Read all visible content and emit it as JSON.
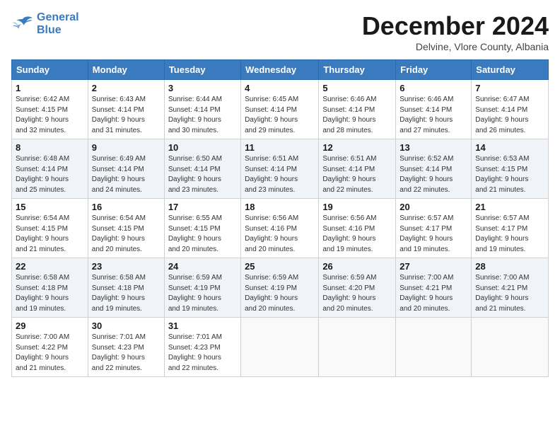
{
  "logo": {
    "line1": "General",
    "line2": "Blue"
  },
  "title": "December 2024",
  "location": "Delvine, Vlore County, Albania",
  "days_header": [
    "Sunday",
    "Monday",
    "Tuesday",
    "Wednesday",
    "Thursday",
    "Friday",
    "Saturday"
  ],
  "weeks": [
    [
      {
        "day": "1",
        "info": "Sunrise: 6:42 AM\nSunset: 4:15 PM\nDaylight: 9 hours\nand 32 minutes."
      },
      {
        "day": "2",
        "info": "Sunrise: 6:43 AM\nSunset: 4:14 PM\nDaylight: 9 hours\nand 31 minutes."
      },
      {
        "day": "3",
        "info": "Sunrise: 6:44 AM\nSunset: 4:14 PM\nDaylight: 9 hours\nand 30 minutes."
      },
      {
        "day": "4",
        "info": "Sunrise: 6:45 AM\nSunset: 4:14 PM\nDaylight: 9 hours\nand 29 minutes."
      },
      {
        "day": "5",
        "info": "Sunrise: 6:46 AM\nSunset: 4:14 PM\nDaylight: 9 hours\nand 28 minutes."
      },
      {
        "day": "6",
        "info": "Sunrise: 6:46 AM\nSunset: 4:14 PM\nDaylight: 9 hours\nand 27 minutes."
      },
      {
        "day": "7",
        "info": "Sunrise: 6:47 AM\nSunset: 4:14 PM\nDaylight: 9 hours\nand 26 minutes."
      }
    ],
    [
      {
        "day": "8",
        "info": "Sunrise: 6:48 AM\nSunset: 4:14 PM\nDaylight: 9 hours\nand 25 minutes."
      },
      {
        "day": "9",
        "info": "Sunrise: 6:49 AM\nSunset: 4:14 PM\nDaylight: 9 hours\nand 24 minutes."
      },
      {
        "day": "10",
        "info": "Sunrise: 6:50 AM\nSunset: 4:14 PM\nDaylight: 9 hours\nand 23 minutes."
      },
      {
        "day": "11",
        "info": "Sunrise: 6:51 AM\nSunset: 4:14 PM\nDaylight: 9 hours\nand 23 minutes."
      },
      {
        "day": "12",
        "info": "Sunrise: 6:51 AM\nSunset: 4:14 PM\nDaylight: 9 hours\nand 22 minutes."
      },
      {
        "day": "13",
        "info": "Sunrise: 6:52 AM\nSunset: 4:14 PM\nDaylight: 9 hours\nand 22 minutes."
      },
      {
        "day": "14",
        "info": "Sunrise: 6:53 AM\nSunset: 4:15 PM\nDaylight: 9 hours\nand 21 minutes."
      }
    ],
    [
      {
        "day": "15",
        "info": "Sunrise: 6:54 AM\nSunset: 4:15 PM\nDaylight: 9 hours\nand 21 minutes."
      },
      {
        "day": "16",
        "info": "Sunrise: 6:54 AM\nSunset: 4:15 PM\nDaylight: 9 hours\nand 20 minutes."
      },
      {
        "day": "17",
        "info": "Sunrise: 6:55 AM\nSunset: 4:15 PM\nDaylight: 9 hours\nand 20 minutes."
      },
      {
        "day": "18",
        "info": "Sunrise: 6:56 AM\nSunset: 4:16 PM\nDaylight: 9 hours\nand 20 minutes."
      },
      {
        "day": "19",
        "info": "Sunrise: 6:56 AM\nSunset: 4:16 PM\nDaylight: 9 hours\nand 19 minutes."
      },
      {
        "day": "20",
        "info": "Sunrise: 6:57 AM\nSunset: 4:17 PM\nDaylight: 9 hours\nand 19 minutes."
      },
      {
        "day": "21",
        "info": "Sunrise: 6:57 AM\nSunset: 4:17 PM\nDaylight: 9 hours\nand 19 minutes."
      }
    ],
    [
      {
        "day": "22",
        "info": "Sunrise: 6:58 AM\nSunset: 4:18 PM\nDaylight: 9 hours\nand 19 minutes."
      },
      {
        "day": "23",
        "info": "Sunrise: 6:58 AM\nSunset: 4:18 PM\nDaylight: 9 hours\nand 19 minutes."
      },
      {
        "day": "24",
        "info": "Sunrise: 6:59 AM\nSunset: 4:19 PM\nDaylight: 9 hours\nand 19 minutes."
      },
      {
        "day": "25",
        "info": "Sunrise: 6:59 AM\nSunset: 4:19 PM\nDaylight: 9 hours\nand 20 minutes."
      },
      {
        "day": "26",
        "info": "Sunrise: 6:59 AM\nSunset: 4:20 PM\nDaylight: 9 hours\nand 20 minutes."
      },
      {
        "day": "27",
        "info": "Sunrise: 7:00 AM\nSunset: 4:21 PM\nDaylight: 9 hours\nand 20 minutes."
      },
      {
        "day": "28",
        "info": "Sunrise: 7:00 AM\nSunset: 4:21 PM\nDaylight: 9 hours\nand 21 minutes."
      }
    ],
    [
      {
        "day": "29",
        "info": "Sunrise: 7:00 AM\nSunset: 4:22 PM\nDaylight: 9 hours\nand 21 minutes."
      },
      {
        "day": "30",
        "info": "Sunrise: 7:01 AM\nSunset: 4:23 PM\nDaylight: 9 hours\nand 22 minutes."
      },
      {
        "day": "31",
        "info": "Sunrise: 7:01 AM\nSunset: 4:23 PM\nDaylight: 9 hours\nand 22 minutes."
      },
      null,
      null,
      null,
      null
    ]
  ]
}
